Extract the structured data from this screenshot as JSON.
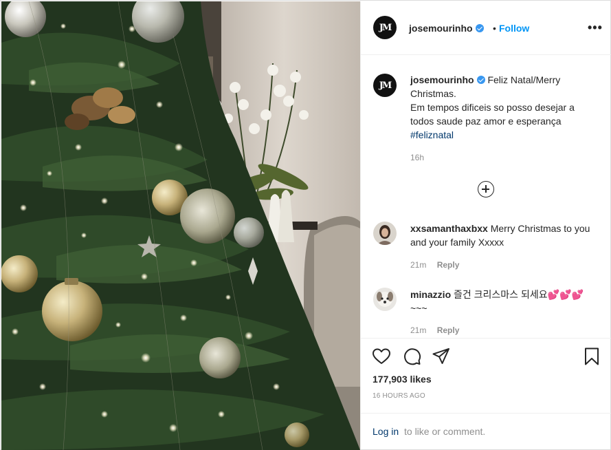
{
  "post": {
    "author": {
      "username": "josemourinho",
      "avatar_initials": "JM",
      "verified": true
    },
    "follow_label": "Follow",
    "separator": "•",
    "more_label": "•••",
    "caption": {
      "line1": "Feliz Natal/Merry Christmas.",
      "line2": "Em tempos dificeis so posso desejar a todos saude paz amor e esperança",
      "hashtag": "#feliznatal",
      "time": "16h"
    },
    "comments": [
      {
        "username": "xxsamanthaxbxx",
        "text": "Merry Christmas to you and your family Xxxxx",
        "time": "21m",
        "reply_label": "Reply"
      },
      {
        "username": "minazzio",
        "text": "즐건 크리스마스 되세요",
        "emoji": "💕💕💕",
        "tail": "~~~",
        "time": "21m",
        "reply_label": "Reply"
      }
    ],
    "likes": "177,903 likes",
    "date": "16 HOURS AGO",
    "login_link": "Log in",
    "login_rest": "to like or comment."
  },
  "colors": {
    "accent": "#0095f6",
    "verified": "#3897f0",
    "link": "#00376b",
    "muted": "#8e8e8e",
    "heart": "#e6304b"
  },
  "icons": [
    "heart-icon",
    "comment-icon",
    "share-icon",
    "bookmark-icon",
    "plus-circle-icon",
    "more-icon",
    "verified-icon"
  ]
}
